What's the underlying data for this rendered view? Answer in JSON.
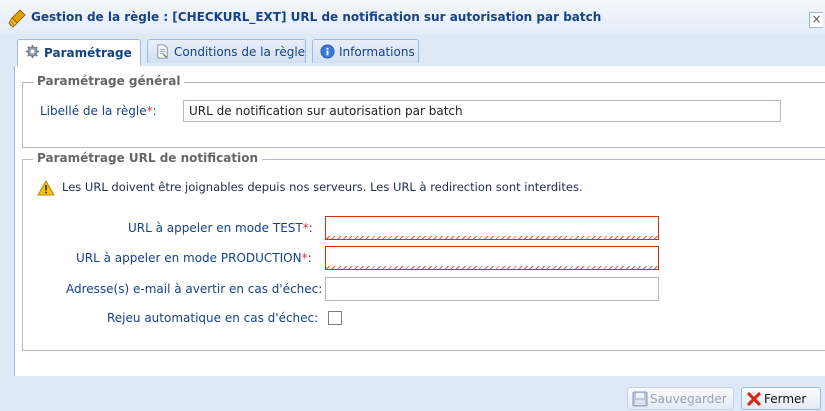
{
  "window": {
    "title": "Gestion de la règle : [CHECKURL_EXT] URL de notification sur autorisation par batch",
    "close_label": "×"
  },
  "tabs": [
    {
      "label": "Paramétrage",
      "icon": "gear-icon",
      "active": true
    },
    {
      "label": "Conditions de la règle",
      "icon": "document-icon",
      "active": false
    },
    {
      "label": "Informations",
      "icon": "info-icon",
      "active": false
    }
  ],
  "general": {
    "legend": "Paramétrage général",
    "rule_label": "Libellé de la règle",
    "required_mark": "*",
    "colon": ":",
    "rule_value": "URL de notification sur autorisation par batch"
  },
  "notification": {
    "legend": "Paramétrage URL de notification",
    "warning": "Les URL doivent être joignables depuis nos serveurs. Les URL à redirection sont interdites.",
    "fields": {
      "test_label": "URL à appeler en mode TEST",
      "test_value": "",
      "prod_label": "URL à appeler en mode PRODUCTION",
      "prod_value": "",
      "email_label": "Adresse(s) e-mail à avertir en cas d'échec:",
      "email_value": "",
      "retry_label": "Rejeu automatique en cas d'échec:",
      "retry_checked": false
    },
    "required_mark": "*",
    "colon": ":"
  },
  "footer": {
    "save_label": "Sauvegarder",
    "close_label": "Fermer"
  },
  "colors": {
    "title_text": "#15428b",
    "window_bg": "#dfe8f6",
    "required": "#e03030",
    "invalid_border": "#cc3300"
  }
}
